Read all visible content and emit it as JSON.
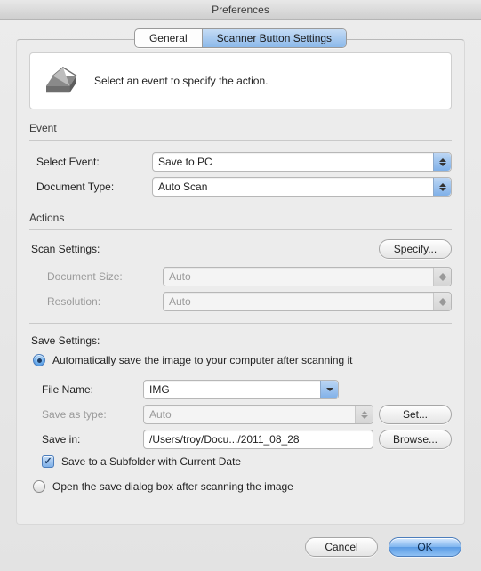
{
  "window": {
    "title": "Preferences"
  },
  "tabs": {
    "general": "General",
    "scanner": "Scanner Button Settings"
  },
  "hero": {
    "text": "Select an event to specify the action."
  },
  "event": {
    "group_label": "Event",
    "select_event_label": "Select Event:",
    "select_event_value": "Save to PC",
    "doc_type_label": "Document Type:",
    "doc_type_value": "Auto Scan"
  },
  "actions": {
    "group_label": "Actions",
    "scan_settings_label": "Scan Settings:",
    "specify_label": "Specify...",
    "doc_size_label": "Document Size:",
    "doc_size_value": "Auto",
    "resolution_label": "Resolution:",
    "resolution_value": "Auto",
    "save_settings_label": "Save Settings:",
    "auto_save_radio": "Automatically save the image to your computer after scanning it",
    "file_name_label": "File Name:",
    "file_name_value": "IMG",
    "save_as_type_label": "Save as type:",
    "save_as_type_value": "Auto",
    "set_button": "Set...",
    "save_in_label": "Save in:",
    "save_in_value": "/Users/troy/Docu.../2011_08_28",
    "browse_button": "Browse...",
    "subfolder_check": "Save to a Subfolder with Current Date",
    "open_dialog_radio": "Open the save dialog box after scanning the image"
  },
  "footer": {
    "cancel": "Cancel",
    "ok": "OK"
  }
}
